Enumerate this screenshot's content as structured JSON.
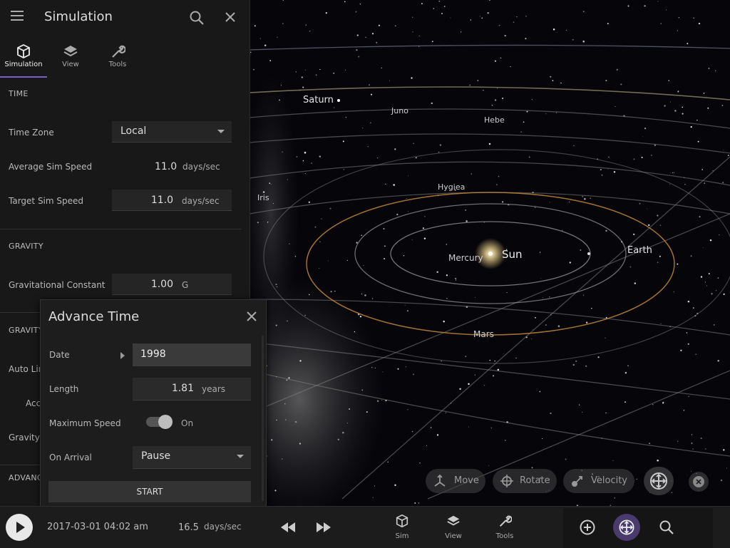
{
  "panel": {
    "title": "Simulation",
    "tabs": [
      {
        "label": "Simulation",
        "icon": "cube-icon",
        "active": true
      },
      {
        "label": "View",
        "icon": "layers-icon",
        "active": false
      },
      {
        "label": "Tools",
        "icon": "wrench-icon",
        "active": false
      }
    ],
    "time_section": "TIME",
    "time_zone_label": "Time Zone",
    "time_zone_value": "Local",
    "avg_speed_label": "Average Sim Speed",
    "avg_speed_value": "11.0",
    "avg_speed_unit": "days/sec",
    "target_speed_label": "Target Sim Speed",
    "target_speed_value": "11.0",
    "target_speed_unit": "days/sec",
    "gravity_section": "GRAVITY",
    "grav_const_label": "Gravitational Constant",
    "grav_const_value": "1.00",
    "grav_const_unit": "G",
    "gravity_section_2": "GRAVITY",
    "auto_label": "Auto Lin",
    "acc_label": "Acc",
    "gravity_label_2": "Gravity",
    "advanced_section": "ADVANC"
  },
  "dialog": {
    "title": "Advance Time",
    "date_label": "Date",
    "date_value": "1998",
    "length_label": "Length",
    "length_value": "1.81",
    "length_unit": "years",
    "max_speed_label": "Maximum Speed",
    "max_speed_state": "On",
    "on_arrival_label": "On Arrival",
    "on_arrival_value": "Pause",
    "start_label": "START"
  },
  "space": {
    "labels": {
      "saturn": "Saturn",
      "juno": "Juno",
      "hebe": "Hebe",
      "hygiea": "Hygiea",
      "iris": "Iris",
      "mercury": "Mercury",
      "sun": "Sun",
      "earth": "Earth",
      "mars": "Mars"
    }
  },
  "tools": {
    "move": "Move",
    "rotate": "Rotate",
    "velocity": "Velocity"
  },
  "bottom": {
    "datetime": "2017-03-01 04:02 am",
    "speed_value": "16.5",
    "speed_unit": "days/sec",
    "tabs": [
      "Sim",
      "View",
      "Tools"
    ]
  },
  "colors": {
    "accent": "#7a5cc8",
    "orbit": "#8a8a8a",
    "mars_orbit": "#c0863a"
  }
}
